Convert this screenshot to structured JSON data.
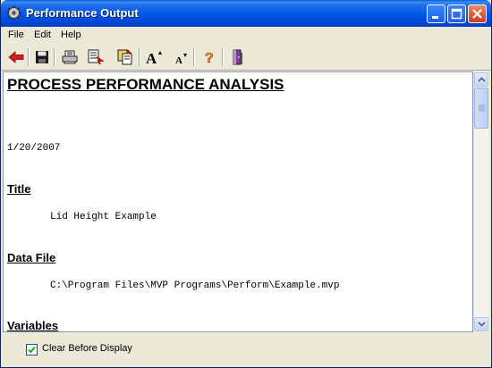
{
  "window": {
    "title": "Performance Output",
    "title_icon": "gear-icon",
    "controls": [
      "minimize-icon",
      "maximize-icon",
      "close-icon"
    ]
  },
  "menu": {
    "file": "File",
    "edit": "Edit",
    "help": "Help"
  },
  "toolbar": {
    "icons": [
      "back-arrow-icon",
      "save-icon",
      "print-icon",
      "print-preview-icon",
      "copy-icon",
      "font-larger-icon",
      "font-smaller-icon",
      "help-icon",
      "exit-door-icon"
    ]
  },
  "document": {
    "title": "PROCESS PERFORMANCE ANALYSIS",
    "date": "1/20/2007",
    "sections": {
      "title_heading": "Title",
      "title_value": "Lid Height Example",
      "datafile_heading": "Data File",
      "datafile_value": "C:\\Program Files\\MVP Programs\\Perform\\Example.mvp",
      "variables_heading": "Variables"
    }
  },
  "options": {
    "clear_before_display_label": "Clear Before Display",
    "clear_before_display_checked": true
  },
  "colors": {
    "titlebar": "#0055e5",
    "window_face": "#ece9d8",
    "back_arrow": "#d21e1e",
    "help_question": "#e0a000"
  }
}
